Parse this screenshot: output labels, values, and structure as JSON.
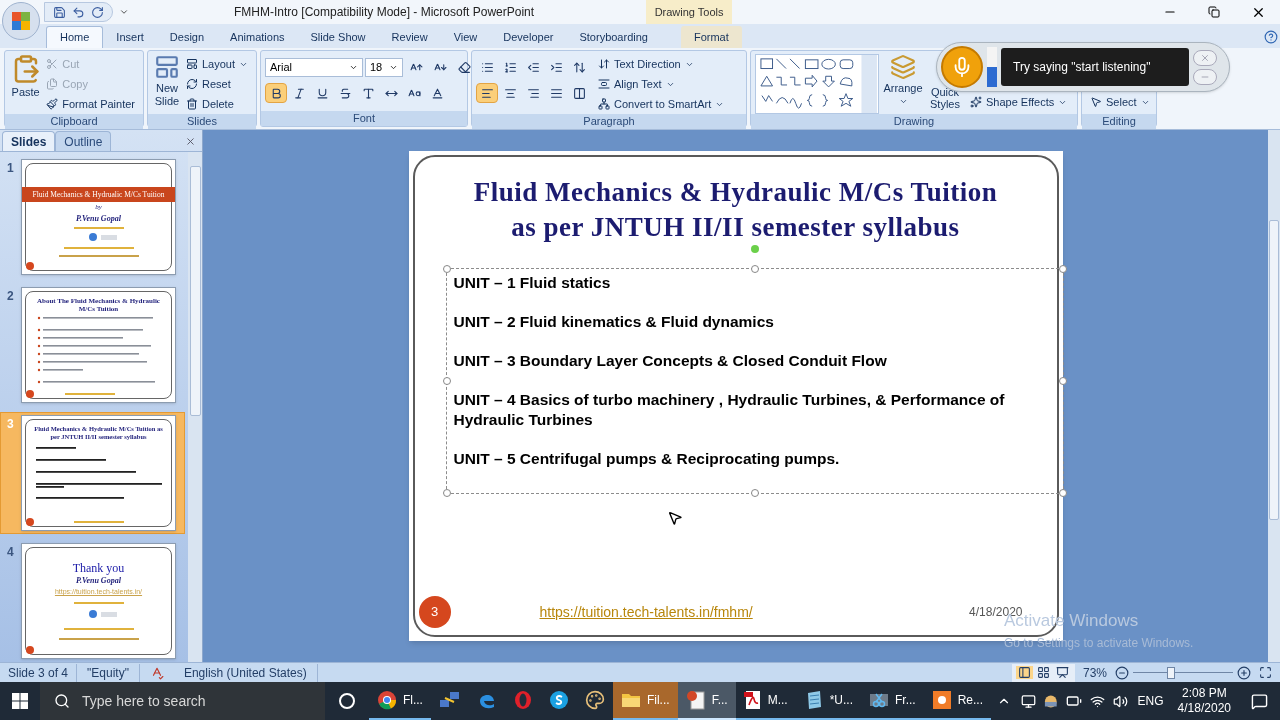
{
  "window": {
    "title": "FMHM-Intro [Compatibility Mode] - Microsoft PowerPoint",
    "contextual_header": "Drawing Tools"
  },
  "ribbon_tabs": [
    {
      "label": "Home",
      "selected": true,
      "contextual": false
    },
    {
      "label": "Insert",
      "selected": false,
      "contextual": false
    },
    {
      "label": "Design",
      "selected": false,
      "contextual": false
    },
    {
      "label": "Animations",
      "selected": false,
      "contextual": false
    },
    {
      "label": "Slide Show",
      "selected": false,
      "contextual": false
    },
    {
      "label": "Review",
      "selected": false,
      "contextual": false
    },
    {
      "label": "View",
      "selected": false,
      "contextual": false
    },
    {
      "label": "Developer",
      "selected": false,
      "contextual": false
    },
    {
      "label": "Storyboarding",
      "selected": false,
      "contextual": false
    },
    {
      "label": "Format",
      "selected": false,
      "contextual": true
    }
  ],
  "groups": [
    {
      "kind": "clipboard",
      "label": "Clipboard",
      "paste": "Paste",
      "items": [
        {
          "label": "Cut",
          "disabled": true
        },
        {
          "label": "Copy",
          "disabled": true
        },
        {
          "label": "Format Painter",
          "disabled": false
        }
      ]
    },
    {
      "kind": "slides",
      "label": "Slides",
      "new_slide": "New Slide",
      "items": [
        "Layout",
        "Reset",
        "Delete"
      ]
    },
    {
      "kind": "font",
      "label": "Font",
      "font_name": "Arial",
      "font_size": "18",
      "bold": true
    },
    {
      "kind": "paragraph",
      "label": "Paragraph",
      "alignment": [
        {
          "kind": "left",
          "selected": true
        },
        {
          "kind": "center",
          "selected": false
        },
        {
          "kind": "right",
          "selected": false
        },
        {
          "kind": "justify",
          "selected": false
        }
      ],
      "items": [
        "Text Direction",
        "Align Text",
        "Convert to SmartArt"
      ]
    },
    {
      "kind": "drawing",
      "label": "Drawing",
      "arrange": "Arrange",
      "quick_styles": "Quick Styles",
      "shape_effects": "Shape Effects"
    },
    {
      "kind": "editing",
      "label": "Editing",
      "select": "Select"
    }
  ],
  "speech_popup": {
    "text": "Try saying \"start listening\""
  },
  "slides_pane": {
    "tabs": [
      {
        "label": "Slides",
        "selected": true
      },
      {
        "label": "Outline",
        "selected": false
      }
    ],
    "thumbnails": [
      {
        "number": "1",
        "selected": false,
        "kind": "cover",
        "title": "Fluid Mechanics & Hydrualic M/Cs Tuition",
        "byline": "by",
        "author": "P.Venu Gopal"
      },
      {
        "number": "2",
        "selected": false,
        "kind": "bullets",
        "title": "About The Fluid Mechanics & Hydraulic M/Cs Tuition"
      },
      {
        "number": "3",
        "selected": true,
        "kind": "units",
        "title": "Fluid Mechanics & Hydraulic M/Cs Tuition as per JNTUH II/II semester syllabus"
      },
      {
        "number": "4",
        "selected": false,
        "kind": "closing",
        "title": "Thank you",
        "author": "P.Venu Gopal",
        "link": "https://tuition.tech-talents.in/"
      }
    ]
  },
  "slide": {
    "title_lines": [
      "Fluid Mechanics & Hydraulic M/Cs Tuition",
      "as per JNTUH II/II semester syllabus"
    ],
    "units": [
      "UNIT – 1 Fluid statics",
      "UNIT – 2 Fluid kinematics & Fluid dynamics",
      "UNIT – 3 Boundary Layer Concepts & Closed Conduit Flow",
      "UNIT – 4 Basics of turbo machinery , Hydraulic Turbines, & Performance of Hydraulic Turbines",
      "UNIT – 5 Centrifugal pumps & Reciprocating pumps."
    ],
    "link": "https://tuition.tech-talents.in/fmhm/",
    "number": "3",
    "date": "4/18/2020"
  },
  "activation_notice": {
    "title": "Activate Windows",
    "text": "Go to Settings to activate Windows."
  },
  "status_bar": {
    "slide": "Slide 3 of 4",
    "theme": "\"Equity\"",
    "language": "English (United States)",
    "zoom": "73%",
    "zoom_slider": {
      "level": 0.38
    }
  },
  "taskbar": {
    "search_placeholder": "Type here to search",
    "apps": [
      {
        "kind": "chrome",
        "label": "Fl...",
        "selected": false,
        "flashing": false,
        "running": true
      },
      {
        "kind": "network",
        "selected": false,
        "flashing": false,
        "running": false
      },
      {
        "kind": "edge",
        "selected": false,
        "flashing": false,
        "running": false
      },
      {
        "kind": "opera",
        "selected": false,
        "flashing": false,
        "running": false
      },
      {
        "kind": "skype",
        "selected": false,
        "flashing": false,
        "running": false
      },
      {
        "kind": "paint",
        "selected": false,
        "flashing": false,
        "running": false
      },
      {
        "kind": "explorer",
        "label": "Fil...",
        "selected": false,
        "flashing": true,
        "running": true
      },
      {
        "kind": "powerpoint",
        "label": "F...",
        "selected": true,
        "flashing": false,
        "running": true
      },
      {
        "kind": "pdf",
        "label": "M...",
        "selected": false,
        "flashing": false,
        "running": true
      },
      {
        "kind": "notepad",
        "label": "*U...",
        "selected": false,
        "flashing": false,
        "running": true
      },
      {
        "kind": "video",
        "label": "Fr...",
        "selected": false,
        "flashing": false,
        "running": true
      },
      {
        "kind": "recorder",
        "label": "Re...",
        "selected": false,
        "flashing": false,
        "running": true
      }
    ],
    "language": "ENG",
    "time": "2:08 PM",
    "date": "4/18/2020"
  }
}
